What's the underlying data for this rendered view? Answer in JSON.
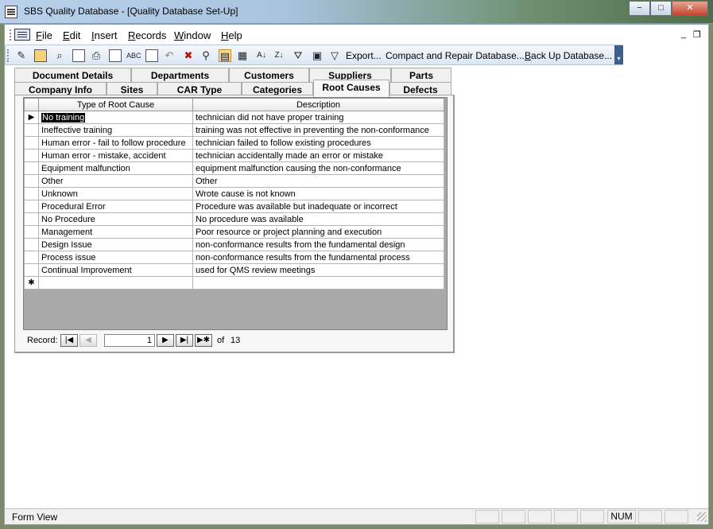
{
  "window": {
    "title": "SBS Quality Database - [Quality Database Set-Up]",
    "minimize_glyph": "−",
    "maximize_glyph": "□",
    "close_glyph": "✕"
  },
  "menu": [
    {
      "underline": "F",
      "rest": "ile"
    },
    {
      "underline": "E",
      "rest": "dit"
    },
    {
      "underline": "I",
      "rest": "nsert"
    },
    {
      "underline": "R",
      "rest": "ecords"
    },
    {
      "underline": "W",
      "rest": "indow"
    },
    {
      "underline": "H",
      "rest": "elp"
    }
  ],
  "mdi": {
    "minimize": "_",
    "restore": "❐"
  },
  "toolbar": {
    "export": "Export...",
    "compact": "Compact and Repair Database...",
    "backup_u": "B",
    "backup_rest": "ack Up Database..."
  },
  "tabs": {
    "row_back": [
      "Document Details",
      "Departments",
      "Customers",
      "Suppliers",
      "Parts"
    ],
    "row_front": [
      "Company Info",
      "Sites",
      "CAR Type",
      "Categories",
      "Root Causes",
      "Defects"
    ],
    "active": "Root Causes"
  },
  "datasheet": {
    "columns": [
      "Type of Root Cause",
      "Description"
    ],
    "rows": [
      {
        "type": "No  training",
        "desc": "technician did not have proper training"
      },
      {
        "type": "Ineffective training",
        "desc": "training was not effective in preventing the non-conformance"
      },
      {
        "type": "Human error - fail to follow procedure",
        "desc": "technician failed to follow existing procedures"
      },
      {
        "type": "Human error - mistake, accident",
        "desc": "technician accidentally made an error or mistake"
      },
      {
        "type": "Equipment malfunction",
        "desc": "equipment malfunction causing the  non-conformance"
      },
      {
        "type": "Other",
        "desc": "Other"
      },
      {
        "type": "Unknown",
        "desc": "Wrote cause is not known"
      },
      {
        "type": "Procedural Error",
        "desc": "Procedure was available but inadequate or incorrect"
      },
      {
        "type": "No Procedure",
        "desc": "No procedure was available"
      },
      {
        "type": "Management",
        "desc": "Poor resource or project planning and execution"
      },
      {
        "type": "Design Issue",
        "desc": "non-conformance results from the fundamental design"
      },
      {
        "type": "Process issue",
        "desc": "non-conformance results from the fundamental process"
      },
      {
        "type": "Continual Improvement",
        "desc": "used for QMS review meetings"
      }
    ],
    "current_marker": "▶",
    "new_marker": "✱"
  },
  "record_nav": {
    "label": "Record:",
    "current": "1",
    "of_label": "of",
    "total": "13",
    "first": "|◀",
    "prev": "◀",
    "next": "▶",
    "last": "▶|",
    "new": "▶✱"
  },
  "status": {
    "form_view": "Form View",
    "num": "NUM"
  }
}
